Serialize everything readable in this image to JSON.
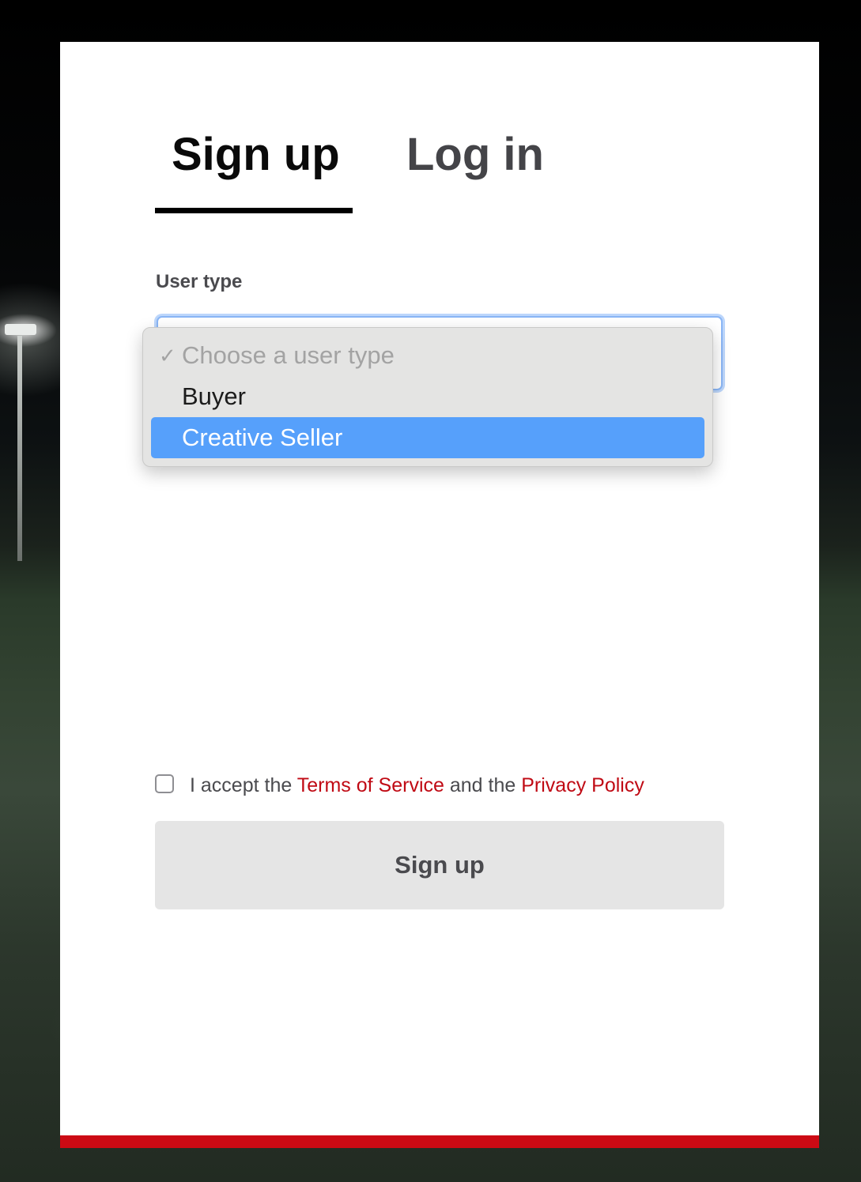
{
  "tabs": {
    "signup_label": "Sign up",
    "login_label": "Log in"
  },
  "form": {
    "user_type_label": "User type",
    "user_type_options": {
      "placeholder": "Choose a user type",
      "buyer": "Buyer",
      "creative_seller": "Creative Seller"
    },
    "terms": {
      "prefix": "I accept the",
      "terms_link": "Terms of Service",
      "middle": "and the",
      "privacy_link": "Privacy Policy"
    },
    "submit_label": "Sign up"
  },
  "colors": {
    "accent_red": "#cc0a14",
    "highlight_blue": "#56a0fb"
  }
}
